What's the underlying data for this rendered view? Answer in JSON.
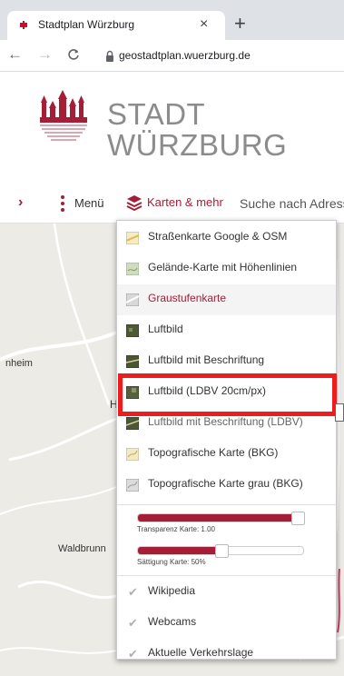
{
  "browser": {
    "tab_title": "Stadtplan Würzburg",
    "tab_close": "×",
    "new_tab": "+",
    "url": "geostadtplan.wuerzburg.de"
  },
  "header": {
    "city_line1": "STADT",
    "city_line2": "WÜRZBURG",
    "brand_color": "#a31e36"
  },
  "navbar": {
    "arrow": "›",
    "menu_label": "Menü",
    "karten_label": "Karten & mehr",
    "search_placeholder": "Suche nach Adress"
  },
  "map": {
    "labels": [
      "nheim",
      "H",
      "Waldbrunn"
    ]
  },
  "dropdown": {
    "maps": [
      {
        "label": "Straßenkarte Google & OSM",
        "icon": "street-map-thumb",
        "state": "normal"
      },
      {
        "label": "Gelände-Karte mit Höhenlinien",
        "icon": "terrain-map-thumb",
        "state": "normal"
      },
      {
        "label": "Graustufenkarte",
        "icon": "grayscale-map-thumb",
        "state": "hover"
      },
      {
        "label": "Luftbild",
        "icon": "aerial-thumb",
        "state": "normal"
      },
      {
        "label": "Luftbild mit Beschriftung",
        "icon": "aerial-labels-thumb",
        "state": "normal"
      },
      {
        "label": "Luftbild (LDBV 20cm/px)",
        "icon": "aerial-ldbv-thumb",
        "state": "normal"
      },
      {
        "label": "Luftbild mit Beschriftung (LDBV)",
        "icon": "aerial-ldbv-labels-thumb",
        "state": "faded"
      },
      {
        "label": "Topografische Karte (BKG)",
        "icon": "topo-map-thumb",
        "state": "normal"
      },
      {
        "label": "Topografische Karte grau (BKG)",
        "icon": "topo-gray-map-thumb",
        "state": "normal"
      }
    ],
    "transparency": {
      "caption": "Transparenz Karte: 1.00",
      "value": 1.0
    },
    "saturation": {
      "caption": "Sättigung Karte: 50%",
      "value": 0.5
    },
    "overlays": [
      {
        "label": "Wikipedia",
        "icon": "check-icon"
      },
      {
        "label": "Webcams",
        "icon": "check-icon"
      },
      {
        "label": "Aktuelle Verkehrslage",
        "icon": "check-icon"
      }
    ]
  }
}
